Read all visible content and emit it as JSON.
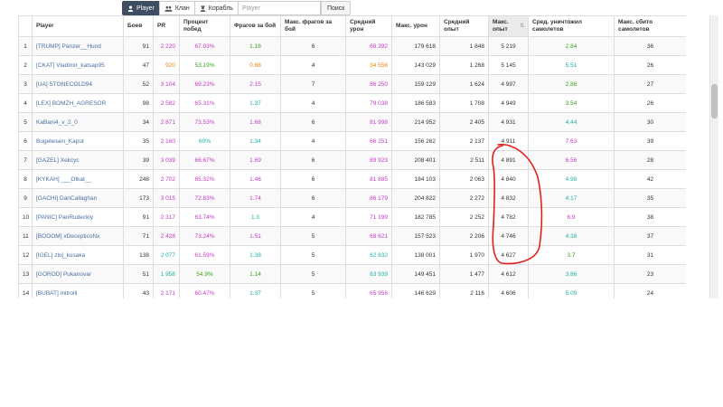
{
  "toolbar": {
    "player_label": "Player",
    "clan_label": "Клан",
    "ship_label": "Корабль",
    "search_placeholder": "Player",
    "search_button": "Поиск"
  },
  "colors": {
    "purple": "#c23ac6",
    "orange": "#e8820c",
    "green": "#3aa21c",
    "teal": "#1bb3a2",
    "link": "#4a6fa0",
    "annotation": "#e0211d"
  },
  "columns": [
    {
      "label": ""
    },
    {
      "label": "Player"
    },
    {
      "label": "Боев"
    },
    {
      "label": "PR"
    },
    {
      "label": "Процент побед"
    },
    {
      "label": "Фрагов за бой"
    },
    {
      "label": "Макс. фрагов за бой"
    },
    {
      "label": "Средний урон"
    },
    {
      "label": "Макс. урон"
    },
    {
      "label": "Средний опыт"
    },
    {
      "label": "Макс. опыт"
    },
    {
      "label": "Сред. уничтожил самолетов"
    },
    {
      "label": "Макс. сбито самолетов"
    }
  ],
  "rows": [
    {
      "rank": "1",
      "player": "[TRUMP] Panzer__Hund",
      "battles": "91",
      "pr": "2 220",
      "pr_color": "purple",
      "winrate": "67.03%",
      "winrate_color": "purple",
      "frags": "1.18",
      "frags_color": "green",
      "max_frags": "6",
      "avg_dmg": "68 392",
      "avg_dmg_color": "purple",
      "max_dmg": "179 618",
      "avg_xp": "1 848",
      "max_xp": "5 219",
      "avg_planes": "2.84",
      "avg_planes_color": "green",
      "max_planes": "36"
    },
    {
      "rank": "2",
      "player": "[CKAT] Vladimir_katsap95",
      "battles": "47",
      "pr": "920",
      "pr_color": "orange",
      "winrate": "53.19%",
      "winrate_color": "green",
      "frags": "0.68",
      "frags_color": "orange",
      "max_frags": "4",
      "avg_dmg": "34 556",
      "avg_dmg_color": "orange",
      "max_dmg": "143 029",
      "avg_xp": "1 268",
      "max_xp": "5 145",
      "avg_planes": "5.51",
      "avg_planes_color": "teal",
      "max_planes": "26"
    },
    {
      "rank": "3",
      "player": "[UA] STONECOLD94",
      "battles": "52",
      "pr": "3 104",
      "pr_color": "purple",
      "winrate": "69.23%",
      "winrate_color": "purple",
      "frags": "2.15",
      "frags_color": "purple",
      "max_frags": "7",
      "avg_dmg": "86 250",
      "avg_dmg_color": "purple",
      "max_dmg": "159 129",
      "avg_xp": "1 624",
      "max_xp": "4 997",
      "avg_planes": "2.88",
      "avg_planes_color": "green",
      "max_planes": "27"
    },
    {
      "rank": "4",
      "player": "[LEX] BOMZH_AGRESOR",
      "battles": "98",
      "pr": "2 582",
      "pr_color": "purple",
      "winrate": "65.31%",
      "winrate_color": "purple",
      "frags": "1.37",
      "frags_color": "teal",
      "max_frags": "4",
      "avg_dmg": "79 038",
      "avg_dmg_color": "purple",
      "max_dmg": "186 583",
      "avg_xp": "1 708",
      "max_xp": "4 949",
      "avg_planes": "3.54",
      "avg_planes_color": "green",
      "max_planes": "26"
    },
    {
      "rank": "5",
      "player": "KaBani4_v_2_0",
      "battles": "34",
      "pr": "2 871",
      "pr_color": "purple",
      "winrate": "73.53%",
      "winrate_color": "purple",
      "frags": "1.68",
      "frags_color": "purple",
      "max_frags": "6",
      "avg_dmg": "81 998",
      "avg_dmg_color": "purple",
      "max_dmg": "214 952",
      "avg_xp": "2 405",
      "max_xp": "4 931",
      "avg_planes": "4.44",
      "avg_planes_color": "teal",
      "max_planes": "30"
    },
    {
      "rank": "6",
      "player": "Bugeleisen_Kaput",
      "battles": "35",
      "pr": "2 160",
      "pr_color": "purple",
      "winrate": "60%",
      "winrate_color": "teal",
      "frags": "1.34",
      "frags_color": "teal",
      "max_frags": "4",
      "avg_dmg": "66 251",
      "avg_dmg_color": "purple",
      "max_dmg": "156 262",
      "avg_xp": "2 137",
      "max_xp": "4 911",
      "avg_planes": "7.63",
      "avg_planes_color": "purple",
      "max_planes": "39"
    },
    {
      "rank": "7",
      "player": "[GAZEL] Xekcyc",
      "battles": "39",
      "pr": "3 039",
      "pr_color": "purple",
      "winrate": "66.67%",
      "winrate_color": "purple",
      "frags": "1.69",
      "frags_color": "purple",
      "max_frags": "6",
      "avg_dmg": "89 923",
      "avg_dmg_color": "purple",
      "max_dmg": "208 401",
      "avg_xp": "2 511",
      "max_xp": "4 891",
      "avg_planes": "6.56",
      "avg_planes_color": "purple",
      "max_planes": "28"
    },
    {
      "rank": "8",
      "player": "[KYKAH] ___Otkat__",
      "battles": "248",
      "pr": "2 702",
      "pr_color": "purple",
      "winrate": "65.32%",
      "winrate_color": "purple",
      "frags": "1.46",
      "frags_color": "purple",
      "max_frags": "6",
      "avg_dmg": "81 885",
      "avg_dmg_color": "purple",
      "max_dmg": "184 103",
      "avg_xp": "2 063",
      "max_xp": "4 840",
      "avg_planes": "4.98",
      "avg_planes_color": "teal",
      "max_planes": "42"
    },
    {
      "rank": "9",
      "player": "[GACHI] DanCallaghan",
      "battles": "173",
      "pr": "3 015",
      "pr_color": "purple",
      "winrate": "72.83%",
      "winrate_color": "purple",
      "frags": "1.74",
      "frags_color": "purple",
      "max_frags": "6",
      "avg_dmg": "86 179",
      "avg_dmg_color": "purple",
      "max_dmg": "204 822",
      "avg_xp": "2 272",
      "max_xp": "4 832",
      "avg_planes": "4.17",
      "avg_planes_color": "teal",
      "max_planes": "35"
    },
    {
      "rank": "10",
      "player": "[PANIC] PanRudeckiy",
      "battles": "91",
      "pr": "2 317",
      "pr_color": "purple",
      "winrate": "63.74%",
      "winrate_color": "purple",
      "frags": "1.3",
      "frags_color": "teal",
      "max_frags": "4",
      "avg_dmg": "71 199",
      "avg_dmg_color": "purple",
      "max_dmg": "182 785",
      "avg_xp": "2 252",
      "max_xp": "4 782",
      "avg_planes": "6.9",
      "avg_planes_color": "purple",
      "max_planes": "38"
    },
    {
      "rank": "11",
      "player": "[BOOOM] xDecepticoNx",
      "battles": "71",
      "pr": "2 428",
      "pr_color": "purple",
      "winrate": "73.24%",
      "winrate_color": "purple",
      "frags": "1.51",
      "frags_color": "purple",
      "max_frags": "5",
      "avg_dmg": "68 621",
      "avg_dmg_color": "purple",
      "max_dmg": "157 523",
      "avg_xp": "2 206",
      "max_xp": "4 746",
      "avg_planes": "4.38",
      "avg_planes_color": "teal",
      "max_planes": "37"
    },
    {
      "rank": "12",
      "player": "[IGEL] zloj_kusaka",
      "battles": "138",
      "pr": "2 077",
      "pr_color": "teal",
      "winrate": "61.59%",
      "winrate_color": "purple",
      "frags": "1.38",
      "frags_color": "teal",
      "max_frags": "5",
      "avg_dmg": "62 832",
      "avg_dmg_color": "teal",
      "max_dmg": "138 001",
      "avg_xp": "1 970",
      "max_xp": "4 627",
      "avg_planes": "3.7",
      "avg_planes_color": "green",
      "max_planes": "31"
    },
    {
      "rank": "13",
      "player": "[GOROD] Pukanovar",
      "battles": "51",
      "pr": "1 958",
      "pr_color": "teal",
      "winrate": "54.9%",
      "winrate_color": "green",
      "frags": "1.14",
      "frags_color": "green",
      "max_frags": "5",
      "avg_dmg": "63 939",
      "avg_dmg_color": "teal",
      "max_dmg": "149 451",
      "avg_xp": "1 477",
      "max_xp": "4 612",
      "avg_planes": "3.86",
      "avg_planes_color": "teal",
      "max_planes": "23"
    },
    {
      "rank": "14",
      "player": "[BUBAT] mitrolli",
      "battles": "43",
      "pr": "2 171",
      "pr_color": "purple",
      "winrate": "60.47%",
      "winrate_color": "purple",
      "frags": "1.37",
      "frags_color": "teal",
      "max_frags": "5",
      "avg_dmg": "65 956",
      "avg_dmg_color": "purple",
      "max_dmg": "146 629",
      "avg_xp": "2 116",
      "max_xp": "4 606",
      "avg_planes": "5.09",
      "avg_planes_color": "teal",
      "max_planes": "24"
    }
  ]
}
